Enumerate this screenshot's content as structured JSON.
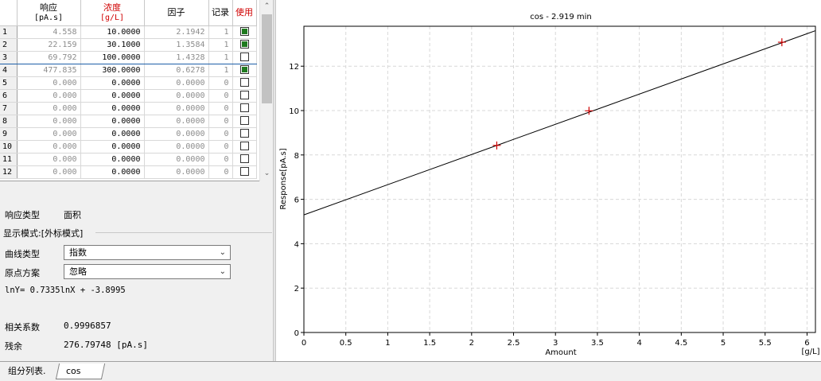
{
  "table": {
    "headers": {
      "response": "响应",
      "response_unit": "[pA.s]",
      "conc": "浓度",
      "conc_unit": "[g/L]",
      "factor": "因子",
      "record": "记录",
      "use": "使用"
    },
    "rows": [
      {
        "n": "1",
        "response": "4.558",
        "conc": "10.0000",
        "factor": "2.1942",
        "record": "1",
        "use": true
      },
      {
        "n": "2",
        "response": "22.159",
        "conc": "30.1000",
        "factor": "1.3584",
        "record": "1",
        "use": true
      },
      {
        "n": "3",
        "response": "69.792",
        "conc": "100.0000",
        "factor": "1.4328",
        "record": "1",
        "use": false
      },
      {
        "n": "4",
        "response": "477.835",
        "conc": "300.0000",
        "factor": "0.6278",
        "record": "1",
        "use": true
      },
      {
        "n": "5",
        "response": "0.000",
        "conc": "0.0000",
        "factor": "0.0000",
        "record": "0",
        "use": false
      },
      {
        "n": "6",
        "response": "0.000",
        "conc": "0.0000",
        "factor": "0.0000",
        "record": "0",
        "use": false
      },
      {
        "n": "7",
        "response": "0.000",
        "conc": "0.0000",
        "factor": "0.0000",
        "record": "0",
        "use": false
      },
      {
        "n": "8",
        "response": "0.000",
        "conc": "0.0000",
        "factor": "0.0000",
        "record": "0",
        "use": false
      },
      {
        "n": "9",
        "response": "0.000",
        "conc": "0.0000",
        "factor": "0.0000",
        "record": "0",
        "use": false
      },
      {
        "n": "10",
        "response": "0.000",
        "conc": "0.0000",
        "factor": "0.0000",
        "record": "0",
        "use": false
      },
      {
        "n": "11",
        "response": "0.000",
        "conc": "0.0000",
        "factor": "0.0000",
        "record": "0",
        "use": false
      },
      {
        "n": "12",
        "response": "0.000",
        "conc": "0.0000",
        "factor": "0.0000",
        "record": "0",
        "use": false
      }
    ]
  },
  "props": {
    "response_type_label": "响应类型",
    "response_type_value": "面积",
    "display_mode": "显示模式:[外标模式]",
    "curve_type_label": "曲线类型",
    "curve_type_value": "指数",
    "origin_label": "原点方案",
    "origin_value": "忽略",
    "equation": "lnY= 0.7335lnX + -3.8995",
    "corr_label": "相关系数",
    "corr_value": "0.9996857",
    "resid_label": "残余",
    "resid_value": "276.79748 [pA.s]"
  },
  "tabs": {
    "component_list": "组分列表.",
    "cos": "cos"
  },
  "icons": {
    "scroll_up": "chevron-up-icon",
    "scroll_down": "chevron-down-icon",
    "dropdown": "chevron-down-icon"
  },
  "colors": {
    "check_fill": "#1f7a1f",
    "point_marker": "#d00000",
    "header_red": "#d00000",
    "selection_border": "#1e5fa8"
  },
  "chart_data": {
    "type": "scatter",
    "title": "cos - 2.919 min",
    "xlabel": "Amount",
    "ylabel": "Response[pA.s]",
    "x_unit": "[g/L]",
    "xlim": [
      0,
      6.1
    ],
    "ylim": [
      0,
      13.8
    ],
    "xticks": [
      "0",
      "0.5",
      "1",
      "1.5",
      "2",
      "2.5",
      "3",
      "3.5",
      "4",
      "4.5",
      "5",
      "5.5",
      "6"
    ],
    "yticks": [
      "0",
      "2",
      "4",
      "6",
      "8",
      "10",
      "12"
    ],
    "grid": true,
    "points": [
      {
        "x": 2.3,
        "y": 8.43
      },
      {
        "x": 3.4,
        "y": 9.99
      },
      {
        "x": 5.7,
        "y": 13.08
      }
    ],
    "fit_line": {
      "x": [
        0,
        6.1
      ],
      "y": [
        5.3,
        13.6
      ]
    }
  }
}
